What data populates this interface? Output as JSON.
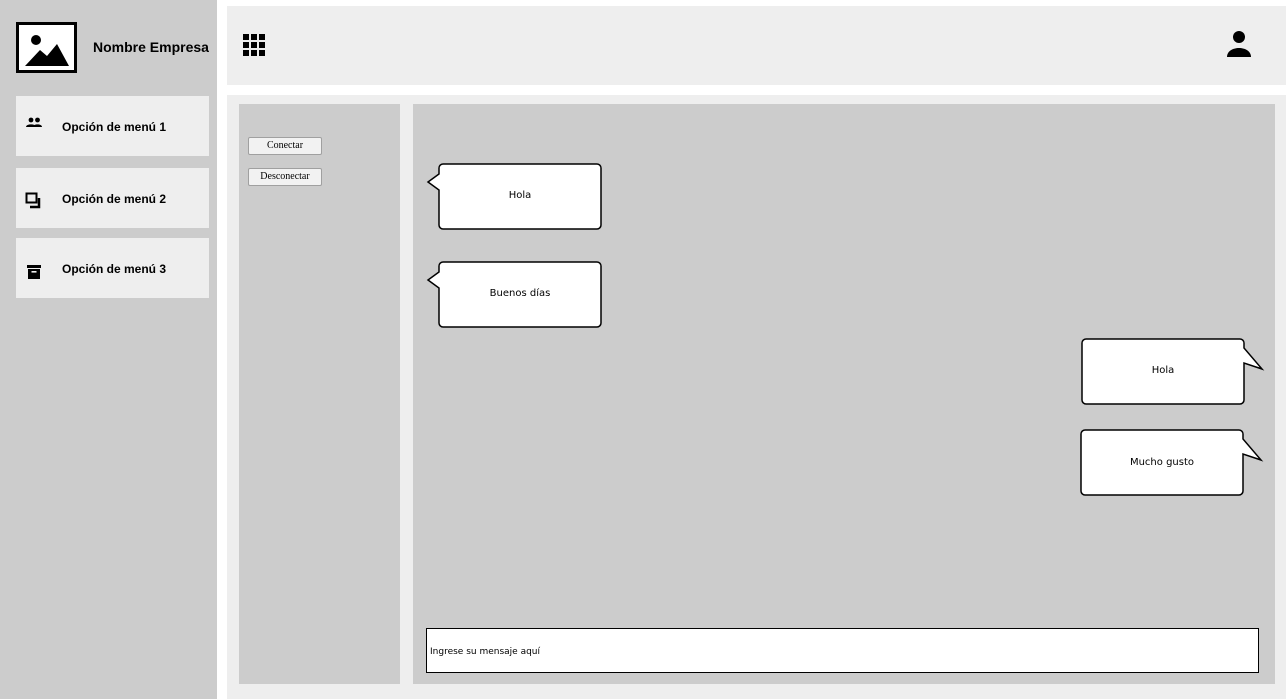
{
  "company": {
    "name": "Nombre Empresa",
    "logo_icon": "image-icon"
  },
  "sidebar": {
    "items": [
      {
        "label": "Opción de menú 1",
        "icon": "people-icon"
      },
      {
        "label": "Opción de menú 2",
        "icon": "layers-icon"
      },
      {
        "label": "Opción de menú 3",
        "icon": "archive-icon"
      }
    ]
  },
  "header": {
    "apps_icon": "apps-grid-icon",
    "user_icon": "user-icon"
  },
  "controls": {
    "connect_label": "Conectar",
    "disconnect_label": "Desconectar"
  },
  "chat": {
    "messages": [
      {
        "text": "Hola",
        "side": "received"
      },
      {
        "text": "Buenos días",
        "side": "received"
      },
      {
        "text": "Hola",
        "side": "sent"
      },
      {
        "text": "Mucho gusto",
        "side": "sent"
      }
    ],
    "input_placeholder": "Ingrese su mensaje aquí"
  },
  "colors": {
    "sidebar_bg": "#cccccc",
    "panel_bg": "#eeeeee",
    "bubble_bg": "#ffffff"
  }
}
